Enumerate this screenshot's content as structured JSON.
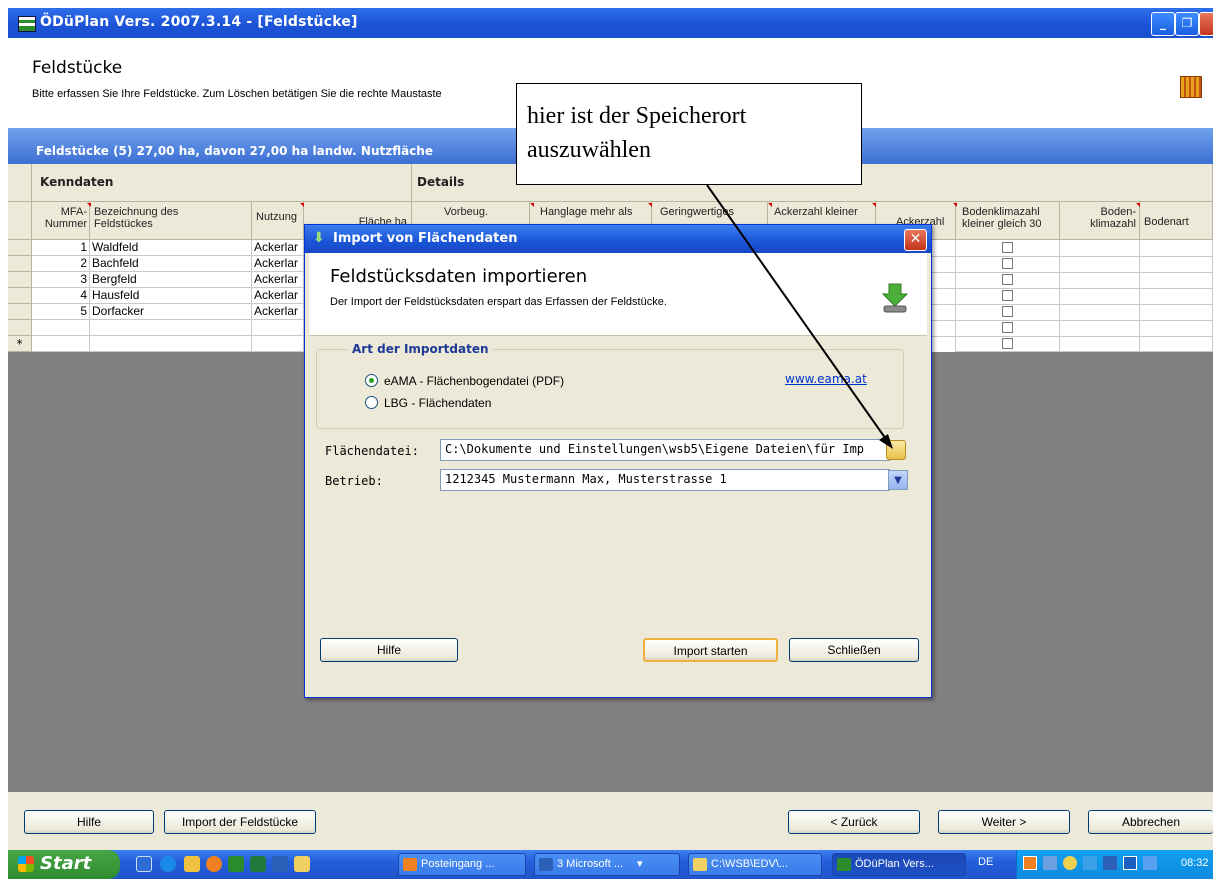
{
  "window": {
    "title": "ÖDüPlan Vers. 2007.3.14 - [Feldstücke]"
  },
  "header": {
    "title": "Feldstücke",
    "subtitle": "Bitte erfassen Sie Ihre Feldstücke.  Zum Löschen betätigen Sie die rechte Maustaste"
  },
  "band": {
    "title": "Feldstücke (5) 27,00 ha, davon 27,00 ha landw. Nutzfläche"
  },
  "grid": {
    "group_left": "Kenndaten",
    "group_right": "Details",
    "columns": {
      "mfa": "MFA-\nNummer",
      "bez": "Bezeichnung des\nFeldstückes",
      "nutzung": "Nutzung",
      "flaeche": "Fläche ha",
      "vorbeug": "Vorbeug.",
      "hang": "Hanglage mehr als",
      "gering": "Geringwertiges",
      "acker_kl": "Ackerzahl kleiner",
      "ackerzahl": "Ackerzahl",
      "bodenkl": "Bodenklimazahl\nkleiner gleich 30",
      "bodenklz": "Boden-\nklimazahl",
      "bodenart": "Bodenart"
    },
    "rows": [
      {
        "nr": "1",
        "name": "Waldfeld",
        "nutzung": "Ackerlar"
      },
      {
        "nr": "2",
        "name": "Bachfeld",
        "nutzung": "Ackerlar"
      },
      {
        "nr": "3",
        "name": "Bergfeld",
        "nutzung": "Ackerlar"
      },
      {
        "nr": "4",
        "name": "Hausfeld",
        "nutzung": "Ackerlar"
      },
      {
        "nr": "5",
        "name": "Dorfacker",
        "nutzung": "Ackerlar"
      }
    ],
    "new_row_marker": "*"
  },
  "dialog": {
    "title": "Import von Flächendaten",
    "heading": "Feldstücksdaten importieren",
    "description": "Der Import der Feldstücksdaten erspart das Erfassen der Feldstücke.",
    "group_label": "Art der Importdaten",
    "radio_eama": "eAMA - Flächenbogendatei (PDF)",
    "radio_lbg": "LBG - Flächendaten",
    "link": "www.eama.at",
    "file_label": "Flächendatei:",
    "file_value": "C:\\Dokumente und Einstellungen\\wsb5\\Eigene Dateien\\für Imp",
    "betrieb_label": "Betrieb:",
    "betrieb_value": "1212345 Mustermann Max, Musterstrasse 1",
    "btn_help": "Hilfe",
    "btn_start": "Import starten",
    "btn_close": "Schließen"
  },
  "callout": {
    "line1": "hier ist der Speicherort",
    "line2": "auszuwählen"
  },
  "footer": {
    "help": "Hilfe",
    "import": "Import der Feldstücke",
    "back": "< Zurück",
    "next": "Weiter >",
    "cancel": "Abbrechen"
  },
  "taskbar": {
    "start": "Start",
    "items": [
      "Posteingang ...",
      "3 Microsoft ...",
      "C:\\WSB\\EDV\\...",
      "ÖDüPlan Vers..."
    ],
    "lang": "DE",
    "clock": "08:32"
  }
}
